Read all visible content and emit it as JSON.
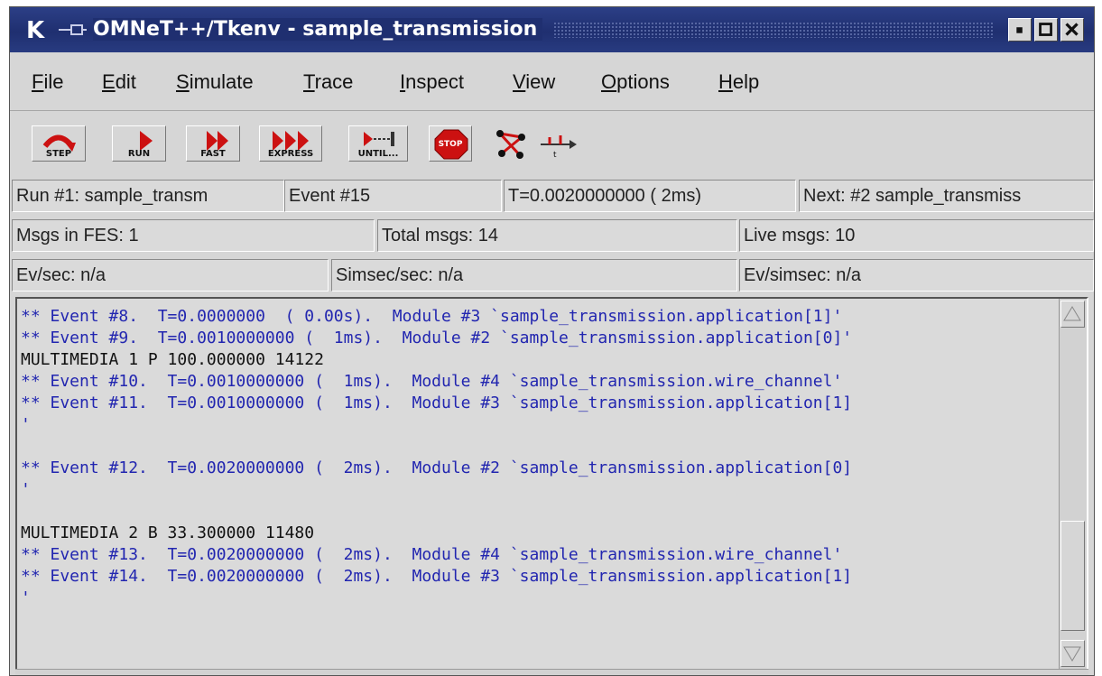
{
  "window": {
    "app_letter": "K",
    "title": "OMNeT++/Tkenv - sample_transmission"
  },
  "menu": {
    "file": {
      "mnemonic": "F",
      "rest": "ile"
    },
    "edit": {
      "mnemonic": "E",
      "rest": "dit"
    },
    "simulate": {
      "mnemonic": "S",
      "rest": "imulate"
    },
    "trace": {
      "mnemonic": "T",
      "rest": "race"
    },
    "inspect": {
      "mnemonic": "I",
      "rest": "nspect"
    },
    "view": {
      "mnemonic": "V",
      "rest": "iew"
    },
    "options": {
      "mnemonic": "O",
      "rest": "ptions"
    },
    "help": {
      "mnemonic": "H",
      "rest": "elp"
    }
  },
  "toolbar": {
    "step": "STEP",
    "run": "RUN",
    "fast": "FAST",
    "express": "EXPRESS",
    "until": "UNTIL...",
    "stop": "STOP",
    "network_icon": "network-graph-icon",
    "timeline_icon": "timeline-icon",
    "accent_red": "#cc1111"
  },
  "status": {
    "run": "Run #1: sample_transm",
    "event": "Event #15",
    "time": "T=0.0020000000 (  2ms)",
    "next": "Next: #2 sample_transmiss",
    "msgs_fes": "Msgs in FES: 1",
    "total_msgs": "Total msgs: 14",
    "live_msgs": "Live msgs: 10",
    "ev_sec": "Ev/sec: n/a",
    "simsec_sec": "Simsec/sec: n/a",
    "ev_simsec": "Ev/simsec: n/a"
  },
  "log": {
    "text_color": "#2226b0",
    "lines": [
      "** Event #8.  T=0.0000000  ( 0.00s).  Module #3 `sample_transmission.application[1]'",
      "** Event #9.  T=0.0010000000 (  1ms).  Module #2 `sample_transmission.application[0]'",
      "MULTIMEDIA 1 P 100.000000 14122",
      "** Event #10.  T=0.0010000000 (  1ms).  Module #4 `sample_transmission.wire_channel'",
      "** Event #11.  T=0.0010000000 (  1ms).  Module #3 `sample_transmission.application[1]",
      "'",
      "",
      "** Event #12.  T=0.0020000000 (  2ms).  Module #2 `sample_transmission.application[0]",
      "'",
      "",
      "MULTIMEDIA 2 B 33.300000 11480",
      "** Event #13.  T=0.0020000000 (  2ms).  Module #4 `sample_transmission.wire_channel'",
      "** Event #14.  T=0.0020000000 (  2ms).  Module #3 `sample_transmission.application[1]",
      "'"
    ]
  }
}
